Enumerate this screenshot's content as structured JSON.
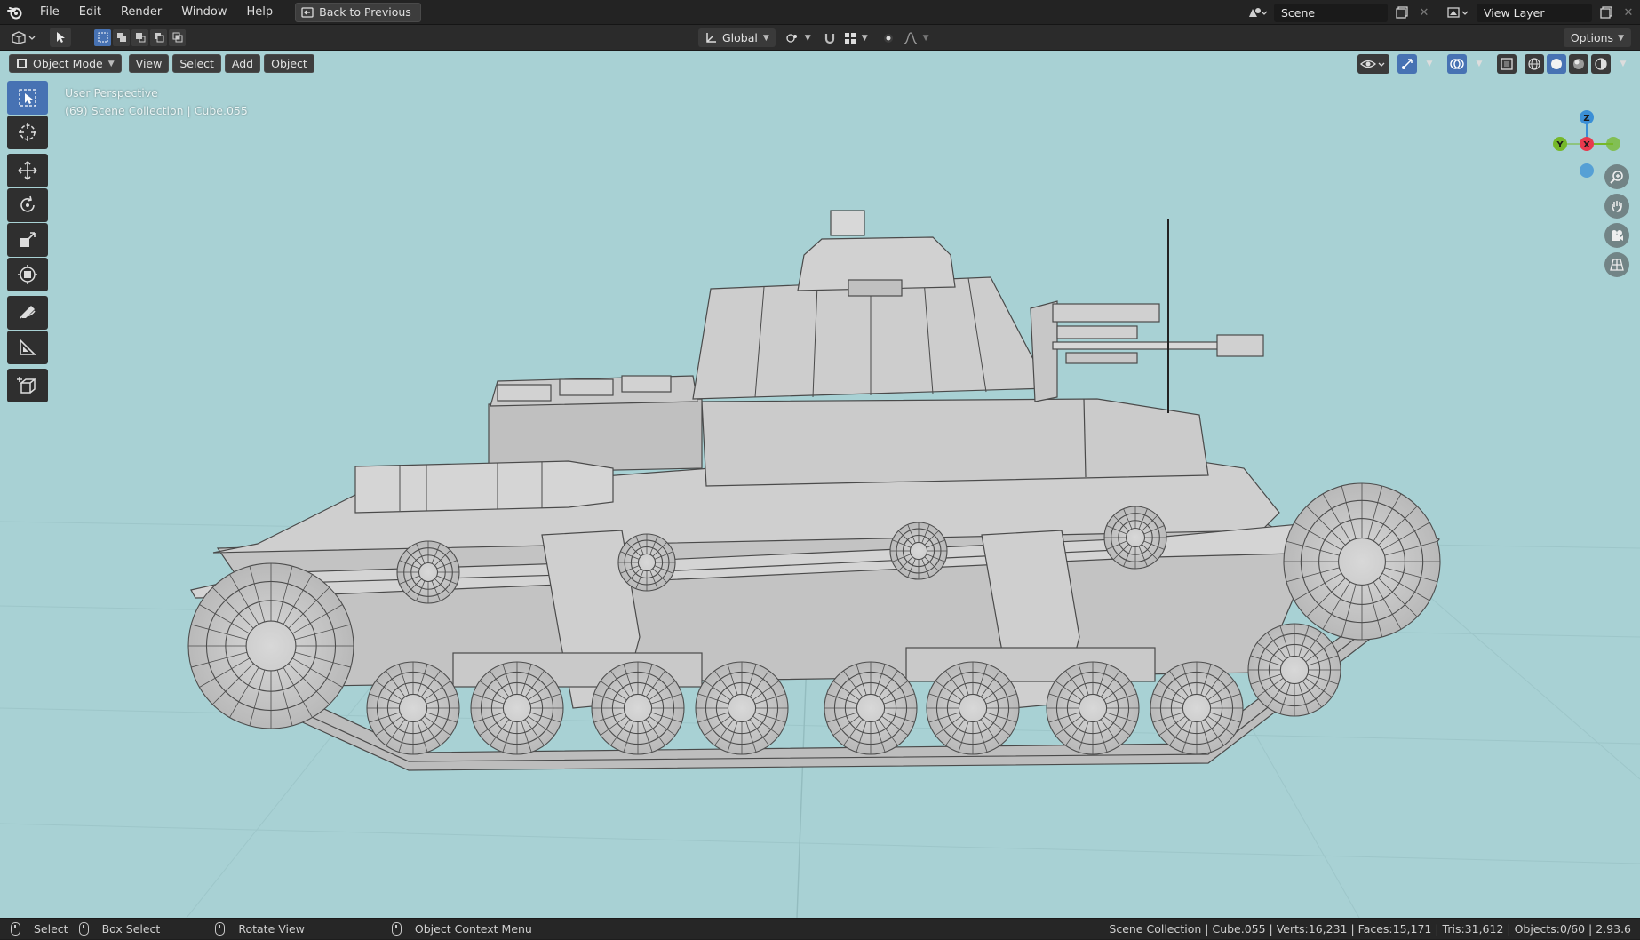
{
  "app": {
    "name": "Blender",
    "logo_icon": "blender-logo-icon"
  },
  "menu": [
    "File",
    "Edit",
    "Render",
    "Window",
    "Help"
  ],
  "back_button": "Back to Previous",
  "scene": {
    "label": "Scene"
  },
  "view_layer": {
    "label": "View Layer"
  },
  "tool_header": {
    "orientation": "Global",
    "options": "Options"
  },
  "viewport": {
    "mode": "Object Mode",
    "menus": [
      "View",
      "Select",
      "Add",
      "Object"
    ],
    "perspective": "User Perspective",
    "collection_info": "(69) Scene Collection | Cube.055",
    "background_color": "#a8d1d4",
    "gizmo_axes": {
      "z": "Z",
      "y": "Y",
      "x": "X"
    },
    "colors": {
      "x_axis": "#e8394d",
      "y_axis": "#76b82a",
      "z_axis": "#3b8fd6",
      "active_blue": "#4772b3"
    }
  },
  "toolbar": [
    "select-box",
    "cursor",
    "move",
    "rotate",
    "scale",
    "transform",
    "annotate",
    "measure",
    "add-cube"
  ],
  "statusbar": {
    "select": "Select",
    "box_select": "Box Select",
    "rotate_view": "Rotate View",
    "context_menu": "Object Context Menu",
    "stats": "Scene Collection | Cube.055 | Verts:16,231 | Faces:15,171 | Tris:31,612 | Objects:0/60 | 2.93.6"
  }
}
